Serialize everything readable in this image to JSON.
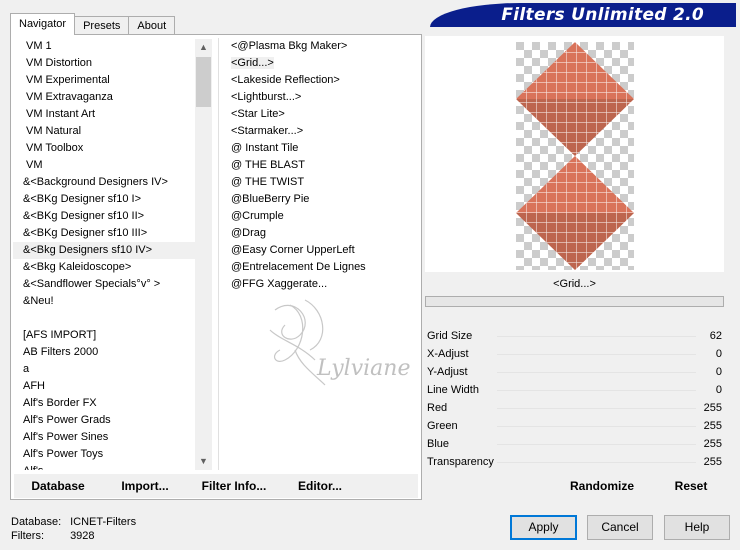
{
  "header": {
    "title": "Filters Unlimited 2.0"
  },
  "tabs": [
    {
      "label": "Navigator",
      "active": true
    },
    {
      "label": "Presets",
      "active": false
    },
    {
      "label": "About",
      "active": false
    }
  ],
  "categories": [
    "VM 1",
    "VM Distortion",
    "VM Experimental",
    "VM Extravaganza",
    "VM Instant Art",
    "VM Natural",
    "VM Toolbox",
    "VM",
    "&<Background Designers IV>",
    "&<BKg Designer sf10 I>",
    "&<BKg Designer sf10 II>",
    "&<BKg Designer sf10 III>",
    "&<Bkg Designers sf10 IV>",
    "&<Bkg Kaleidoscope>",
    "&<Sandflower Specials°v° >",
    "&Neu!",
    "",
    "[AFS IMPORT]",
    "AB Filters 2000",
    "a",
    "AFH",
    "Alf's Border FX",
    "Alf's Power Grads",
    "Alf's Power Sines",
    "Alf's Power Toys",
    "Alf's..."
  ],
  "selected_category_index": 12,
  "filters": [
    "<@Plasma Bkg Maker>",
    "<Grid...>",
    "<Lakeside Reflection>",
    "<Lightburst...>",
    "<Star Lite>",
    "<Starmaker...>",
    "@ Instant Tile",
    "@ THE BLAST",
    "@ THE TWIST",
    "@BlueBerry Pie",
    "@Crumple",
    "@Drag",
    "@Easy Corner UpperLeft",
    "@Entrelacement De Lignes",
    "@FFG Xaggerate..."
  ],
  "selected_filter_index": 1,
  "watermark_text": "Lylviane",
  "tab_buttons": {
    "database": "Database",
    "import": "Import...",
    "filter_info": "Filter Info...",
    "editor": "Editor..."
  },
  "preview": {
    "label": "<Grid...>",
    "fill_color": "#d9735a",
    "dark_color": "#8a4a38"
  },
  "params": [
    {
      "name": "Grid Size",
      "value": "62"
    },
    {
      "name": "X-Adjust",
      "value": "0"
    },
    {
      "name": "Y-Adjust",
      "value": "0"
    },
    {
      "name": "Line Width",
      "value": "0"
    },
    {
      "name": "Red",
      "value": "255"
    },
    {
      "name": "Green",
      "value": "255"
    },
    {
      "name": "Blue",
      "value": "255"
    },
    {
      "name": "Transparency",
      "value": "255"
    }
  ],
  "param_buttons": {
    "randomize": "Randomize",
    "reset": "Reset"
  },
  "footer": {
    "database_label": "Database:",
    "database_value": "ICNET-Filters",
    "filters_label": "Filters:",
    "filters_value": "3928"
  },
  "dialog_buttons": {
    "apply": "Apply",
    "cancel": "Cancel",
    "help": "Help"
  }
}
